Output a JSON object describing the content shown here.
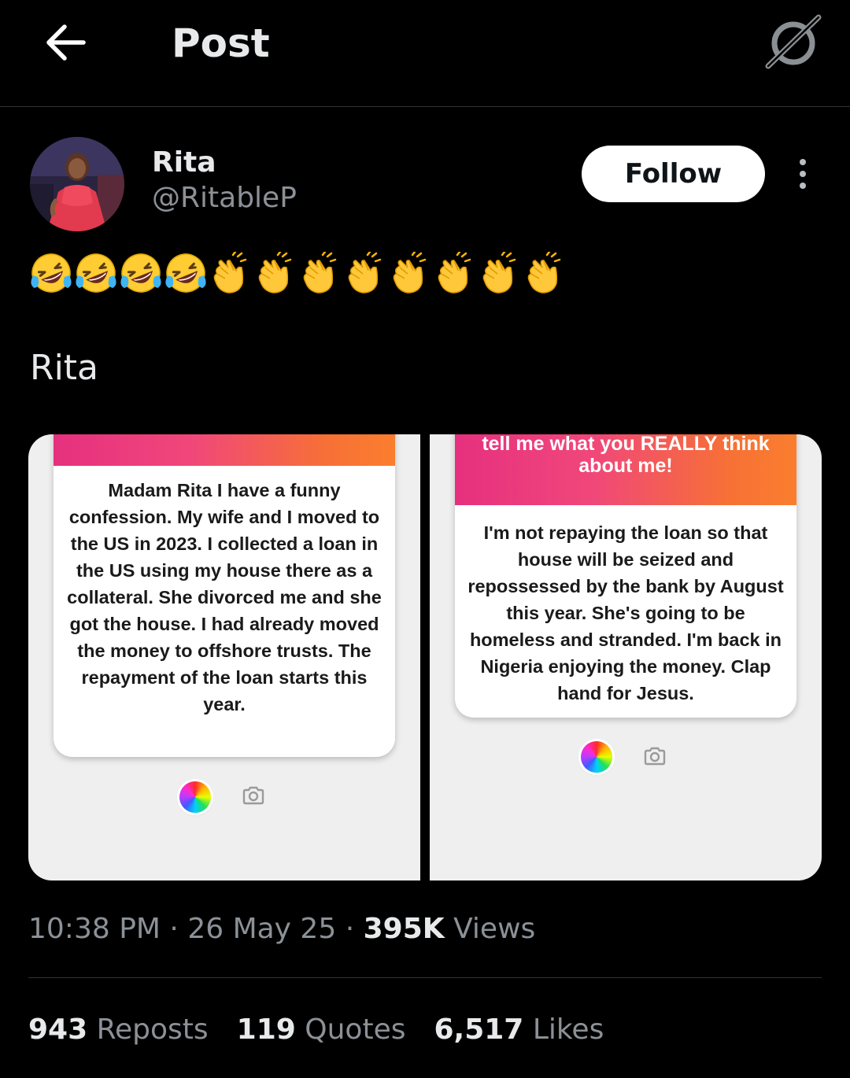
{
  "header": {
    "title": "Post",
    "back_icon": "arrow-left-icon",
    "grok_icon": "grok-icon"
  },
  "author": {
    "name": "Rita",
    "handle": "@RitableP",
    "follow_label": "Follow"
  },
  "post": {
    "emoji_sequence": [
      "🤣",
      "🤣",
      "🤣",
      "🤣",
      "👏",
      "👏",
      "👏",
      "👏",
      "👏",
      "👏",
      "👏",
      "👏"
    ],
    "text": "Rita",
    "images": [
      {
        "header_text": "",
        "body": "Madam Rita I have a funny confession. My wife and I moved to the US in 2023. I collected a loan in the US using my house there as a collateral. She divorced me and she got the house. I had already moved the money to offshore trusts. The repayment of the loan starts this year."
      },
      {
        "header_text": "tell me what you REALLY think about me!",
        "body": "I'm not repaying the loan so that house will be seized and repossessed by the bank by August this year. She's going to be homeless and stranded. I'm back in Nigeria enjoying the money. Clap hand for Jesus."
      }
    ]
  },
  "meta": {
    "time": "10:38 PM",
    "sep1": " · ",
    "date": "26 May 25",
    "sep2": " · ",
    "views_count": "395K",
    "views_label": " Views"
  },
  "stats": {
    "reposts_count": "943",
    "reposts_label": "Reposts",
    "quotes_count": "119",
    "quotes_label": "Quotes",
    "likes_count": "6,517",
    "likes_label": "Likes"
  },
  "colors": {
    "background": "#000000",
    "text": "#e7e9ea",
    "secondary": "#8b9197",
    "divider": "#2f3336",
    "gradient_start": "#e6307f",
    "gradient_end": "#fa7e2e"
  }
}
